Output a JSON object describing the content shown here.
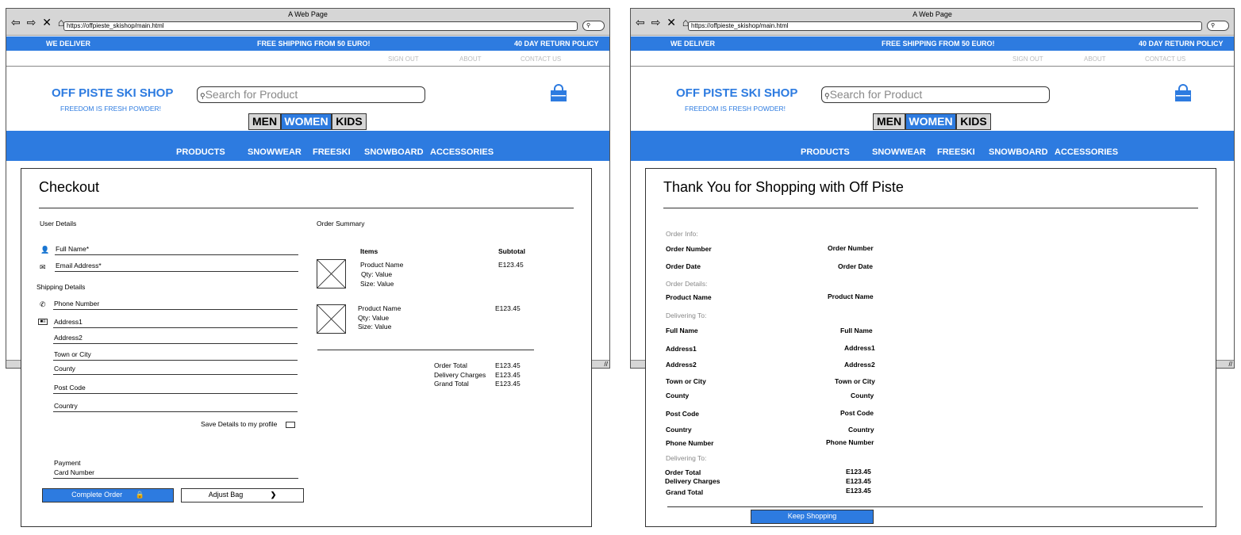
{
  "browser": {
    "title": "A Web Page",
    "url": "https://offpieste_skishop/main.html",
    "nav_icons": "⇦ ⇨ ✕ ⌂",
    "search_icon": "magnifier-icon"
  },
  "promo_bar": {
    "left": "WE DELIVER",
    "center": "FREE SHIPPING FROM 50 EURO!",
    "right": "40 DAY RETURN POLICY"
  },
  "top_links": {
    "sign_out": "SIGN OUT",
    "about": "ABOUT",
    "contact": "CONTACT US"
  },
  "header": {
    "logo": "OFF PISTE SKI SHOP",
    "tagline": "FREEDOM IS FRESH POWDER!",
    "search_placeholder": "Search for Product",
    "bag_icon": "shopping-bag-icon"
  },
  "gender_tabs": [
    {
      "label": "MEN",
      "selected": false
    },
    {
      "label": "WOMEN",
      "selected": true
    },
    {
      "label": "KIDS",
      "selected": false
    }
  ],
  "categories": [
    "PRODUCTS",
    "SNOWWEAR",
    "FREESKI",
    "SNOWBOARD",
    "ACCESSORIES"
  ],
  "colors": {
    "accent": "#2d7be0",
    "chrome": "#d6d6d6"
  },
  "checkout": {
    "title": "Checkout",
    "user_details": "User Details",
    "full_name": "Full Name*",
    "email": "Email Address*",
    "shipping_details": "Shipping Details",
    "phone": "Phone Number",
    "address1": "Address1",
    "address2": "Address2",
    "town": "Town or City",
    "county": "County",
    "post_code": "Post Code",
    "country": "Country",
    "save_details": "Save Details to my profile",
    "payment": "Payment",
    "card_number": "Card Number",
    "complete_order": "Complete Order",
    "adjust_bag": "Adjust Bag",
    "order_summary": "Order Summary",
    "items_header": "Items",
    "subtotal_header": "Subtotal",
    "items": [
      {
        "name": "Product Name",
        "qty": "Qty: Value",
        "size": "Size: Value",
        "subtotal": "E123.45"
      },
      {
        "name": "Product Name",
        "qty": "Qty: Value",
        "size": "Size: Value",
        "subtotal": "E123.45"
      }
    ],
    "totals": [
      {
        "label": "Order Total",
        "value": "E123.45"
      },
      {
        "label": "Delivery Charges",
        "value": "E123.45"
      },
      {
        "label": "Grand Total",
        "value": "E123.45"
      }
    ]
  },
  "thankyou": {
    "title": "Thank You for Shopping with Off Piste",
    "order_info": "Order Info:",
    "order_number_label": "Order Number",
    "order_number_value": "Order Number",
    "order_date_label": "Order Date",
    "order_date_value": "Order Date",
    "order_details": "Order Details:",
    "product_name_label": "Product Name",
    "product_name_value": "Product Name",
    "delivering_to": "Delivering To:",
    "rows": [
      {
        "label": "Full Name",
        "value": "Full Name"
      },
      {
        "label": "Address1",
        "value": "Address1"
      },
      {
        "label": "Address2",
        "value": "Address2"
      },
      {
        "label": "Town or City",
        "value": "Town or City"
      },
      {
        "label": "County",
        "value": "County"
      },
      {
        "label": "Post Code",
        "value": "Post Code"
      },
      {
        "label": "Country",
        "value": "Country"
      },
      {
        "label": "Phone Number",
        "value": "Phone Number"
      }
    ],
    "delivering_to_2": "Delivering To:",
    "totals": [
      {
        "label": "Order Total",
        "value": "E123.45"
      },
      {
        "label": "Delivery Charges",
        "value": "E123.45"
      },
      {
        "label": "Grand Total",
        "value": "E123.45"
      }
    ],
    "keep_shopping": "Keep Shopping"
  }
}
